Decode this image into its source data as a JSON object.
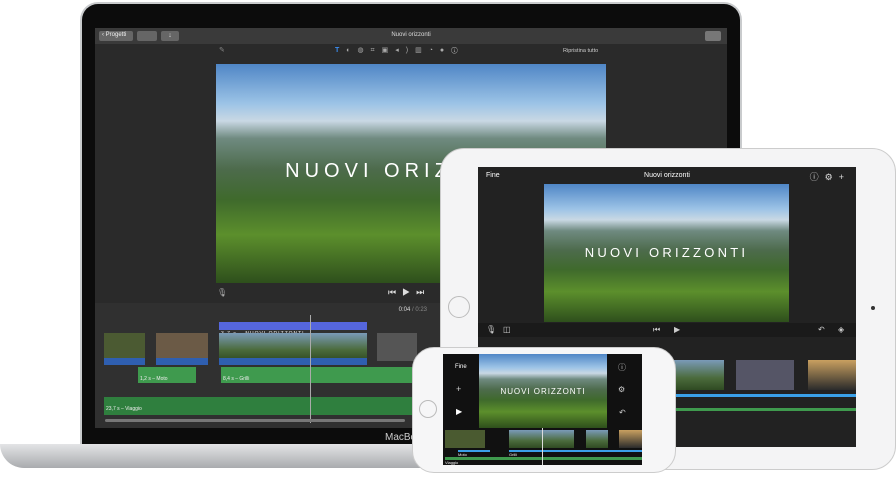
{
  "mac": {
    "toolbar": {
      "back": "Progetti",
      "title": "Nuovi orizzonti",
      "reset": "Ripristina tutto"
    },
    "tools": [
      "magic-wand",
      "title",
      "color-balance",
      "color-correction",
      "crop",
      "stabilization",
      "volume",
      "noise-reduction",
      "speed",
      "filter",
      "info"
    ],
    "video_title": "NUOVI ORIZZONTI",
    "time_current": "0:04",
    "time_sep": "/",
    "time_total": "0:23",
    "title_clip": "3,7 s – NUOVI ORIZZONTI",
    "audio1": "1,2 s – Moto",
    "audio2": "8,4 s – Grilli",
    "music": "23,7 s – Viaggio",
    "brand": "MacBo"
  },
  "ipad": {
    "done": "Fine",
    "title": "Nuovi orizzonti",
    "video_title": "NUOVI ORIZZONTI"
  },
  "iphone": {
    "done": "Fine",
    "video_title": "NUOVI ORIZZONTI",
    "audio1": "Moto",
    "audio2": "Grilli",
    "music": "Viaggio"
  }
}
